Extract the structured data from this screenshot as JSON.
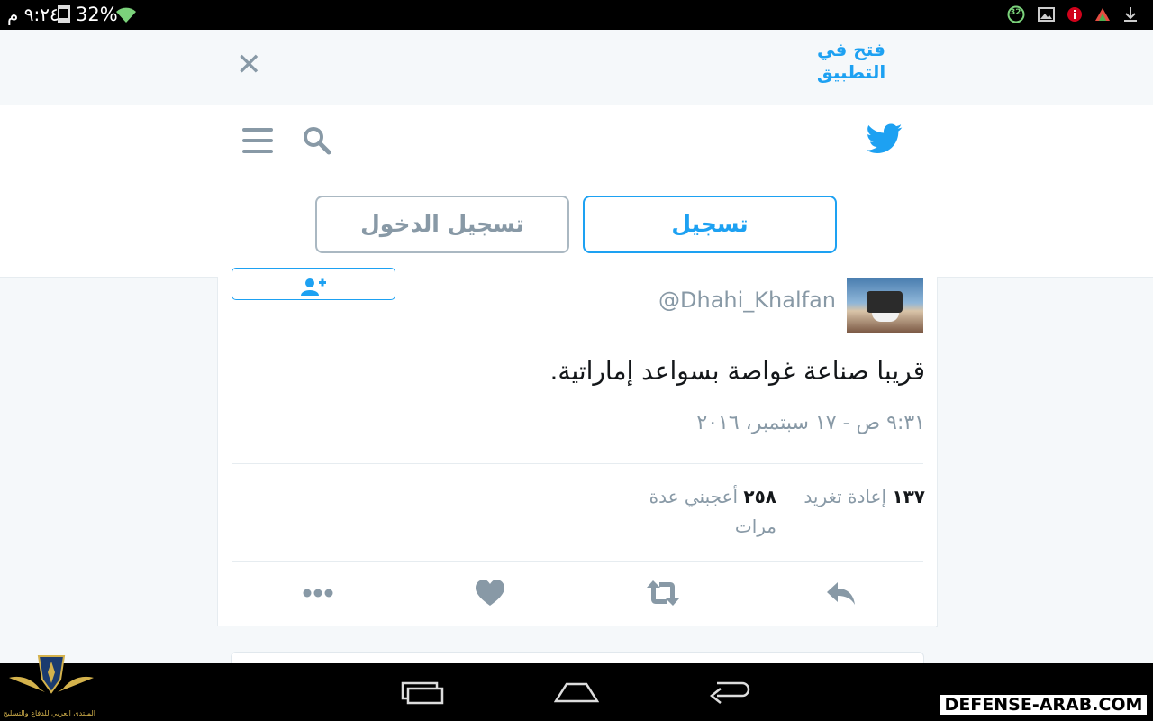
{
  "status_bar": {
    "time": "٩:٢٤ م",
    "battery_percent": "32%",
    "notification_badge": "32",
    "icons": [
      "wifi-icon",
      "sync-badge-icon",
      "image-icon",
      "info-red-icon",
      "store-icon",
      "download-icon"
    ]
  },
  "open_app_bar": {
    "open_in_app": "فتح في التطبيق",
    "close_icon": "close-icon"
  },
  "header": {
    "signup_label": "تسجيل",
    "login_label": "تسجيل الدخول",
    "icons": [
      "menu-icon",
      "search-icon",
      "twitter-bird-icon"
    ]
  },
  "tweet": {
    "handle": "@Dhahi_Khalfan",
    "text": "قريبا صناعة غواصة بسواعد إماراتية.",
    "timestamp": "٩:٣١ ص - ١٧ سبتمبر، ٢٠١٦",
    "retweets": {
      "count": "١٣٧",
      "label": "إعادة تغريد"
    },
    "likes": {
      "count": "٢٥٨",
      "label": "أعجبني عدة مرات"
    },
    "actions": [
      "reply-icon",
      "retweet-icon",
      "like-icon",
      "more-icon"
    ]
  },
  "colors": {
    "accent": "#1da1f2",
    "muted": "#8899a6",
    "text": "#14171a",
    "background": "#f5f8fa"
  },
  "watermark": {
    "site": "DEFENSE-ARAB.COM",
    "forum_name": "المنتدى العربي للدفاع والتسليح"
  }
}
